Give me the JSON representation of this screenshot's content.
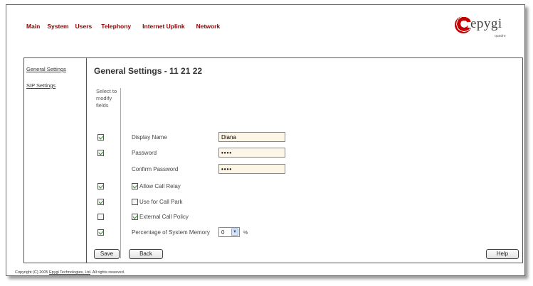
{
  "nav": {
    "items": [
      "Main",
      "System",
      "Users",
      "Telephony",
      "Internet Uplink",
      "Network"
    ]
  },
  "logo": {
    "text": "epygi",
    "subtext": "quadro"
  },
  "sidebar": {
    "items": [
      {
        "label": "General Settings"
      },
      {
        "label": "SIP Settings"
      }
    ]
  },
  "page": {
    "title": "General Settings - 11 21 22"
  },
  "select_header": "Select to modify fields",
  "fields": {
    "display_name": {
      "label": "Display Name",
      "value": "Diana",
      "selected": true
    },
    "password": {
      "label": "Password",
      "value": "••••",
      "selected": true
    },
    "confirm_password": {
      "label": "Confirm Password",
      "value": "••••"
    },
    "allow_call_relay": {
      "label": "Allow Call Relay",
      "checked": true,
      "selected": true
    },
    "use_for_call_park": {
      "label": "Use for Call Park",
      "checked": false,
      "selected": true
    },
    "external_call_policy": {
      "label": "External Call Policy",
      "checked": true,
      "selected": false
    },
    "memory": {
      "label": "Percentage of System Memory",
      "value": "0",
      "unit": "%",
      "selected": true
    }
  },
  "buttons": {
    "save": "Save",
    "back": "Back",
    "help": "Help"
  },
  "footer": {
    "prefix": "Copyright (C) 2005 ",
    "link": "Epygi Technologies, Ltd",
    "suffix": ". All rights reserved."
  },
  "colors": {
    "nav_text": "#8b0000",
    "field_bg": "#fdf6e6",
    "check": "#2a8a2a",
    "logo_red": "#c40000"
  }
}
